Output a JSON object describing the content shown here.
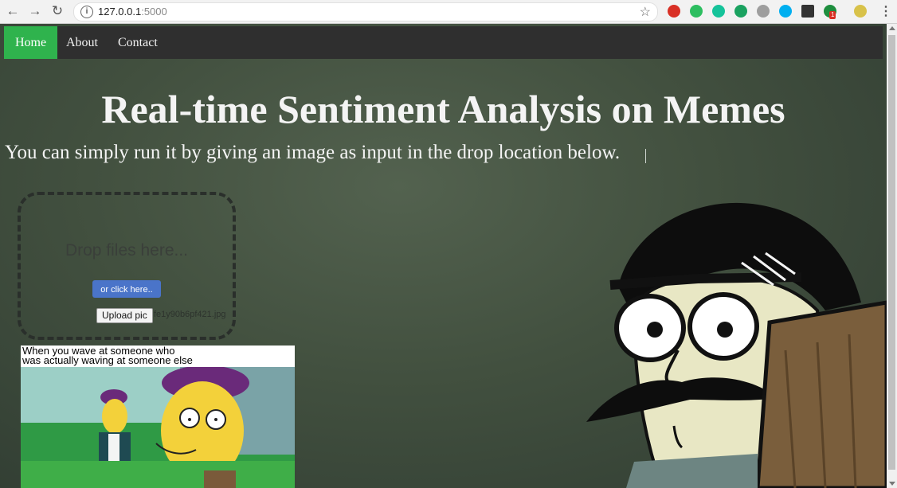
{
  "browser": {
    "url_host": "127.0.0.1",
    "url_port": ":5000",
    "extension_icons": [
      "ublock-icon",
      "evernote-icon",
      "grammarly-icon",
      "green-ext-icon",
      "gray-ext-icon",
      "skype-icon",
      "x-ext-icon",
      "badge-ext-icon",
      "avatar-icon"
    ],
    "badge_count": "1"
  },
  "nav": {
    "items": [
      {
        "label": "Home",
        "active": true
      },
      {
        "label": "About",
        "active": false
      },
      {
        "label": "Contact",
        "active": false
      }
    ]
  },
  "hero": {
    "title": "Real-time Sentiment Analysis on Memes",
    "subtitle": "You can simply run it by giving an image as input in the drop location below."
  },
  "dropzone": {
    "text": "Drop files here...",
    "click_label": "or click here..",
    "upload_label": "Upload pic",
    "file_name": "fe1y90b6pf421.jpg"
  },
  "meme": {
    "caption": "When you wave at someone who\nwas actually waving at someone else"
  },
  "colors": {
    "nav_active": "#2fb34d",
    "nav_bg": "#2f2f2f",
    "click_button": "#4a74c9"
  }
}
